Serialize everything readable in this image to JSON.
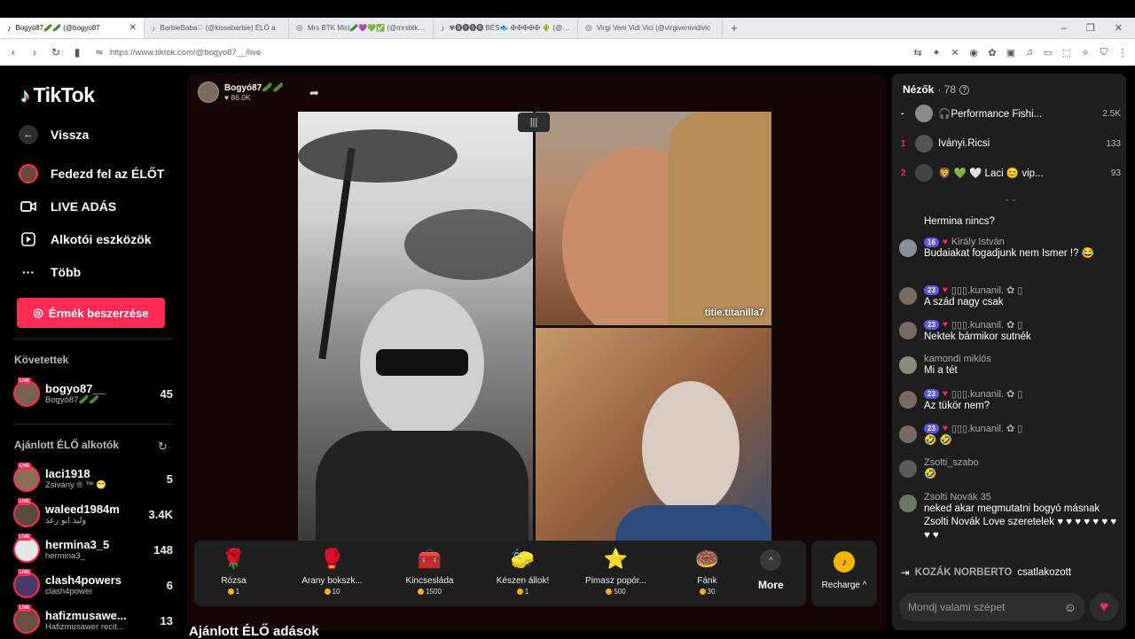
{
  "browser": {
    "tabs": [
      {
        "title": "Bogyó87🥒🥒 (@bogyo87",
        "icon": "♪",
        "active": true
      },
      {
        "title": "BarbieBaba♡ (@kissabarbie) ÉLŐ a",
        "icon": "♪",
        "active": false
      },
      {
        "title": "Mrs BTK Mici🥒💜💚✅ (@mrsbtk) É",
        "icon": "◎",
        "active": false
      },
      {
        "title": "✾🅑🅨🅢🅡 BÉS🐟 ✠✠✠✠✠ 🌵 (@csby0",
        "icon": "♪",
        "active": false
      },
      {
        "title": "Virgi Veni Vidi Vici (@virgivenividivic",
        "icon": "◎",
        "active": false
      }
    ],
    "close_tab": "✕",
    "new_tab": "+",
    "url": "https://www.tiktok.com/@bogyo87__/live",
    "window_controls": [
      "–",
      "❐",
      "✕"
    ],
    "extensions": [
      "⇆",
      "✦",
      "✕",
      "◉",
      "✿",
      "▣",
      "♫",
      "▭",
      "⬚",
      "✧",
      "⛉",
      "⋮"
    ]
  },
  "sidebar": {
    "logo_icon": "♪",
    "logo_text": "TikTok",
    "back_label": "Vissza",
    "nav": [
      {
        "label": "Fedezd fel az ÉLŐT",
        "icon": "avatar"
      },
      {
        "label": "LIVE ADÁS",
        "icon": "camera-icon"
      },
      {
        "label": "Alkotói eszközök",
        "icon": "play-icon"
      },
      {
        "label": "Több",
        "icon": "more-icon"
      }
    ],
    "coins_button": "Érmék beszerzése",
    "followed_title": "Követettek",
    "followed": [
      {
        "name": "bogyo87__",
        "sub": "Bogyó87🥒🥒",
        "count": "45"
      }
    ],
    "recommended_title": "Ajánlott ÉLŐ alkotók",
    "recommended": [
      {
        "name": "laci1918",
        "sub": "Zsivány ® ™ 😁",
        "count": "5"
      },
      {
        "name": "waleed1984m",
        "sub": "وليد ابو رعد",
        "count": "3.4K"
      },
      {
        "name": "hermina3_5",
        "sub": "hermina3_",
        "count": "148"
      },
      {
        "name": "clash4powers",
        "sub": "clash4power",
        "count": "6"
      },
      {
        "name": "hafizmusawe...",
        "sub": "Hafizmusawer recit...",
        "count": "13"
      }
    ],
    "live_badge": "LIVE"
  },
  "stream": {
    "host_name": "Bogyó87🥒🥒",
    "host_likes": "♥ 86.0K",
    "share_icon": "➦",
    "audio_badge": "|||",
    "guest_name": "titie.titanilla7",
    "gifts": [
      {
        "name": "Rózsa",
        "price": "1",
        "icon": "🌹"
      },
      {
        "name": "Arany bokszk...",
        "price": "10",
        "icon": "🥊"
      },
      {
        "name": "Kincsesláda",
        "price": "1500",
        "icon": "🧰"
      },
      {
        "name": "Készen állok!",
        "price": "1",
        "icon": "🧽"
      },
      {
        "name": "Pimasz popór...",
        "price": "500",
        "icon": "⭐"
      },
      {
        "name": "Fánk",
        "price": "30",
        "icon": "🍩"
      }
    ],
    "more_label": "More",
    "more_icon": "^",
    "recharge_label": "Recharge ^",
    "recharge_icon": "♪",
    "recommended_title": "Ajánlott ÉLŐ adások"
  },
  "chat": {
    "viewers_label": "Nézők",
    "viewers_count": "· 78",
    "info_icon": "?",
    "top_viewers": [
      {
        "rank": "-",
        "name": "🎧Performance Fishi...",
        "score": "2.5K"
      },
      {
        "rank": "1",
        "name": "Iványi.Ricsi",
        "score": "133"
      },
      {
        "rank": "2",
        "name": "🦁 💚 🤍 Laci 😊 vip...",
        "score": "93"
      }
    ],
    "collapse_icon": "⌄⌄",
    "messages": [
      {
        "user": "",
        "level": "",
        "text": "Hermina nincs?"
      },
      {
        "user": "Király István",
        "level": "16",
        "text": "Budaiakat fogadjunk nem Ismer !? 😂"
      },
      {
        "user": "▯▯▯.kunanil. ✿ ▯",
        "level": "23",
        "text": "A szád nagy csak"
      },
      {
        "user": "▯▯▯.kunanil. ✿ ▯",
        "level": "23",
        "text": "Nektek bármikor sutnék"
      },
      {
        "user": "kamondi miklós",
        "level": "",
        "text": "Mi a tét"
      },
      {
        "user": "▯▯▯.kunanil. ✿ ▯",
        "level": "23",
        "text": "Az tükör nem?"
      },
      {
        "user": "▯▯▯.kunanil. ✿ ▯",
        "level": "23",
        "text": "🤣 🤣"
      },
      {
        "user": "Zsolti_szabo",
        "level": "",
        "text": "🤣"
      },
      {
        "user": "Zsolti Novák 35",
        "level": "",
        "text": "neked akar megmutatni bogyó másnak Zsolti Novák Love szeretelek ♥ ♥ ♥ ♥ ♥ ♥ ♥ ♥ ♥"
      }
    ],
    "join_icon": "⇥",
    "join_user": "KOZÁK NORBERTO",
    "join_text": "csatlakozott",
    "input_placeholder": "Mondj valami szépet",
    "emoji_icon": "☺",
    "heart_icon": "♥"
  },
  "colors": {
    "accent": "#fe2c55",
    "level_badge": "#5b57e6",
    "coin": "#f5b500"
  }
}
